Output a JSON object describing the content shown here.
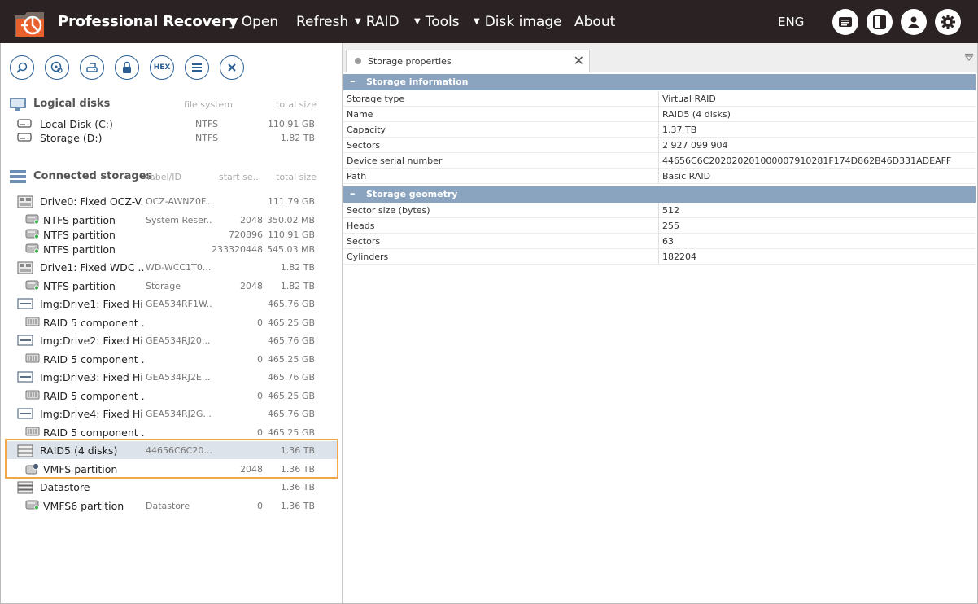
{
  "app": {
    "title": "Professional Recovery"
  },
  "menu": {
    "open": "Open",
    "refresh": "Refresh",
    "raid": "RAID",
    "tools": "Tools",
    "disk_image": "Disk image",
    "about": "About",
    "lang": "ENG"
  },
  "toolbar": {
    "hex": "HEX"
  },
  "logical": {
    "title": "Logical disks",
    "col_fs": "file system",
    "col_size": "total size",
    "items": [
      {
        "name": "Local Disk (C:)",
        "fs": "NTFS",
        "size": "110.91 GB"
      },
      {
        "name": "Storage (D:)",
        "fs": "NTFS",
        "size": "1.82 TB"
      }
    ]
  },
  "connected": {
    "title": "Connected storages",
    "col_label": "label/ID",
    "col_start": "start se...",
    "col_size": "total size",
    "items": [
      {
        "name": "Drive0: Fixed OCZ-V...",
        "label": "OCZ-AWNZ0F...",
        "start": "",
        "size": "111.79 GB"
      },
      {
        "name": "NTFS partition",
        "label": "System Reser...",
        "start": "2048",
        "size": "350.02 MB"
      },
      {
        "name": "NTFS partition",
        "label": "",
        "start": "720896",
        "size": "110.91 GB"
      },
      {
        "name": "NTFS partition",
        "label": "",
        "start": "233320448",
        "size": "545.03 MB"
      },
      {
        "name": "Drive1: Fixed WDC ...",
        "label": "WD-WCC1T0...",
        "start": "",
        "size": "1.82 TB"
      },
      {
        "name": "NTFS partition",
        "label": "Storage",
        "start": "2048",
        "size": "1.82 TB"
      },
      {
        "name": "Img:Drive1: Fixed Hi...",
        "label": "GEA534RF1W...",
        "start": "",
        "size": "465.76 GB"
      },
      {
        "name": "RAID 5 component ...",
        "label": "",
        "start": "0",
        "size": "465.25 GB"
      },
      {
        "name": "Img:Drive2: Fixed Hi...",
        "label": "GEA534RJ20...",
        "start": "",
        "size": "465.76 GB"
      },
      {
        "name": "RAID 5 component ...",
        "label": "",
        "start": "0",
        "size": "465.25 GB"
      },
      {
        "name": "Img:Drive3: Fixed Hi...",
        "label": "GEA534RJ2E...",
        "start": "",
        "size": "465.76 GB"
      },
      {
        "name": "RAID 5 component ...",
        "label": "",
        "start": "0",
        "size": "465.25 GB"
      },
      {
        "name": "Img:Drive4: Fixed Hi...",
        "label": "GEA534RJ2G...",
        "start": "",
        "size": "465.76 GB"
      },
      {
        "name": "RAID 5 component ...",
        "label": "",
        "start": "0",
        "size": "465.25 GB"
      },
      {
        "name": "RAID5 (4 disks)",
        "label": "44656C6C20...",
        "start": "",
        "size": "1.36 TB"
      },
      {
        "name": "VMFS partition",
        "label": "",
        "start": "2048",
        "size": "1.36 TB"
      },
      {
        "name": "Datastore",
        "label": "",
        "start": "",
        "size": "1.36 TB"
      },
      {
        "name": "VMFS6 partition",
        "label": "Datastore",
        "start": "0",
        "size": "1.36 TB"
      }
    ]
  },
  "props": {
    "tab": "Storage properties",
    "info_title": "Storage information",
    "info": [
      {
        "k": "Storage type",
        "v": "Virtual RAID"
      },
      {
        "k": "Name",
        "v": "RAID5 (4 disks)"
      },
      {
        "k": "Capacity",
        "v": "1.37 TB"
      },
      {
        "k": "Sectors",
        "v": "2 927 099 904"
      },
      {
        "k": "Device serial number",
        "v": "44656C6C20202020100000791028 1F174D862B46D331ADEAFF"
      },
      {
        "k": "Path",
        "v": "Basic RAID"
      }
    ],
    "geo_title": "Storage geometry",
    "geo": [
      {
        "k": "Sector size (bytes)",
        "v": "512"
      },
      {
        "k": "Heads",
        "v": "255"
      },
      {
        "k": "Sectors",
        "v": "63"
      },
      {
        "k": "Cylinders",
        "v": "182204"
      }
    ]
  }
}
